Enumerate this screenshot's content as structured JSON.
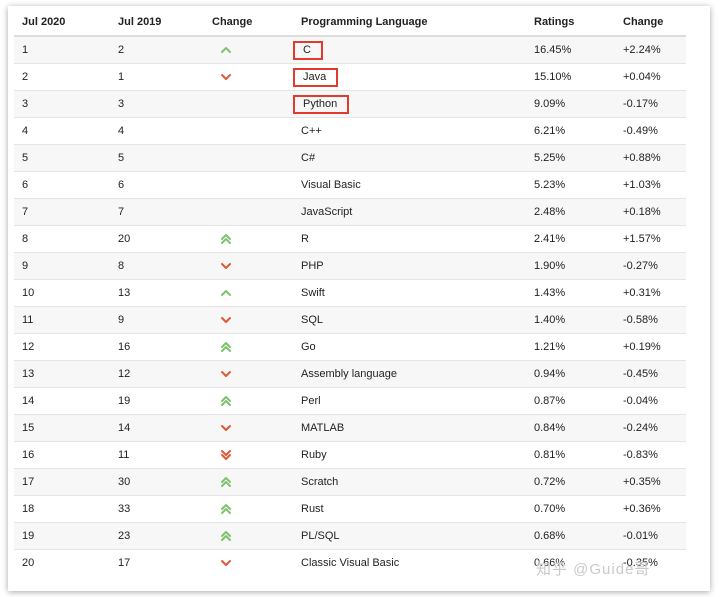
{
  "headers": {
    "rank_now": "Jul 2020",
    "rank_prev": "Jul 2019",
    "change": "Change",
    "language": "Programming Language",
    "ratings": "Ratings",
    "change_pct": "Change"
  },
  "colors": {
    "up": "#7dc36b",
    "down": "#e05a34",
    "highlight_box": "#e23b2e"
  },
  "rows": [
    {
      "rank": "1",
      "prev": "2",
      "trend": "up",
      "language": "C",
      "rating": "16.45%",
      "change": "+2.24%",
      "highlighted": true
    },
    {
      "rank": "2",
      "prev": "1",
      "trend": "down",
      "language": "Java",
      "rating": "15.10%",
      "change": "+0.04%",
      "highlighted": true
    },
    {
      "rank": "3",
      "prev": "3",
      "trend": "none",
      "language": "Python",
      "rating": "9.09%",
      "change": "-0.17%",
      "highlighted": true
    },
    {
      "rank": "4",
      "prev": "4",
      "trend": "none",
      "language": "C++",
      "rating": "6.21%",
      "change": "-0.49%"
    },
    {
      "rank": "5",
      "prev": "5",
      "trend": "none",
      "language": "C#",
      "rating": "5.25%",
      "change": "+0.88%"
    },
    {
      "rank": "6",
      "prev": "6",
      "trend": "none",
      "language": "Visual Basic",
      "rating": "5.23%",
      "change": "+1.03%"
    },
    {
      "rank": "7",
      "prev": "7",
      "trend": "none",
      "language": "JavaScript",
      "rating": "2.48%",
      "change": "+0.18%"
    },
    {
      "rank": "8",
      "prev": "20",
      "trend": "double-up",
      "language": "R",
      "rating": "2.41%",
      "change": "+1.57%"
    },
    {
      "rank": "9",
      "prev": "8",
      "trend": "down",
      "language": "PHP",
      "rating": "1.90%",
      "change": "-0.27%"
    },
    {
      "rank": "10",
      "prev": "13",
      "trend": "up",
      "language": "Swift",
      "rating": "1.43%",
      "change": "+0.31%"
    },
    {
      "rank": "11",
      "prev": "9",
      "trend": "down",
      "language": "SQL",
      "rating": "1.40%",
      "change": "-0.58%"
    },
    {
      "rank": "12",
      "prev": "16",
      "trend": "double-up",
      "language": "Go",
      "rating": "1.21%",
      "change": "+0.19%"
    },
    {
      "rank": "13",
      "prev": "12",
      "trend": "down",
      "language": "Assembly language",
      "rating": "0.94%",
      "change": "-0.45%"
    },
    {
      "rank": "14",
      "prev": "19",
      "trend": "double-up",
      "language": "Perl",
      "rating": "0.87%",
      "change": "-0.04%"
    },
    {
      "rank": "15",
      "prev": "14",
      "trend": "down",
      "language": "MATLAB",
      "rating": "0.84%",
      "change": "-0.24%"
    },
    {
      "rank": "16",
      "prev": "11",
      "trend": "double-down",
      "language": "Ruby",
      "rating": "0.81%",
      "change": "-0.83%"
    },
    {
      "rank": "17",
      "prev": "30",
      "trend": "double-up",
      "language": "Scratch",
      "rating": "0.72%",
      "change": "+0.35%"
    },
    {
      "rank": "18",
      "prev": "33",
      "trend": "double-up",
      "language": "Rust",
      "rating": "0.70%",
      "change": "+0.36%"
    },
    {
      "rank": "19",
      "prev": "23",
      "trend": "double-up",
      "language": "PL/SQL",
      "rating": "0.68%",
      "change": "-0.01%"
    },
    {
      "rank": "20",
      "prev": "17",
      "trend": "down",
      "language": "Classic Visual Basic",
      "rating": "0.66%",
      "change": "-0.35%"
    }
  ],
  "watermark": "知乎 @Guide哥"
}
